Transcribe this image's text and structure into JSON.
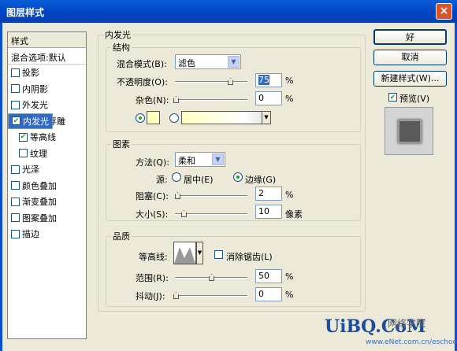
{
  "window": {
    "title": "图层样式"
  },
  "styles": {
    "header": "样式",
    "blending": "混合选项:默认",
    "items": [
      {
        "label": "投影",
        "checked": false
      },
      {
        "label": "内阴影",
        "checked": false
      },
      {
        "label": "外发光",
        "checked": false
      },
      {
        "label": "内发光",
        "checked": true,
        "selected": true
      },
      {
        "label": "斜面和浮雕",
        "checked": true
      },
      {
        "label": "等高线",
        "checked": true
      },
      {
        "label": "纹理",
        "checked": false
      },
      {
        "label": "光泽",
        "checked": false
      },
      {
        "label": "颜色叠加",
        "checked": false
      },
      {
        "label": "渐变叠加",
        "checked": false
      },
      {
        "label": "图案叠加",
        "checked": false
      },
      {
        "label": "描边",
        "checked": false
      }
    ]
  },
  "main": {
    "title": "内发光"
  },
  "structure": {
    "title": "结构",
    "blend_label": "混合模式(B):",
    "blend_value": "滤色",
    "opacity_label": "不透明度(O):",
    "opacity_value": "75",
    "noise_label": "杂色(N):",
    "noise_value": "0",
    "percent": "%",
    "glow_color": "#ffffc0"
  },
  "elements": {
    "title": "图素",
    "technique_label": "方法(Q):",
    "technique_value": "柔和",
    "source_label": "源:",
    "center_label": "居中(E)",
    "edge_label": "边缘(G)",
    "choke_label": "阻塞(C):",
    "choke_value": "2",
    "size_label": "大小(S):",
    "size_value": "10",
    "percent": "%",
    "unit": "像素"
  },
  "quality": {
    "title": "品质",
    "contour_label": "等高线:",
    "antialias_label": "消除锯齿(L)",
    "range_label": "范围(R):",
    "range_value": "50",
    "jitter_label": "抖动(J):",
    "jitter_value": "0",
    "percent": "%"
  },
  "buttons": {
    "ok": "好",
    "cancel": "取消",
    "new_style": "新建样式(W)...",
    "preview": "预览(V)"
  },
  "watermark": {
    "logo": "UiBQ.CoM",
    "cn": "网络学院",
    "url": "www.eNet.com.cn/eschool"
  }
}
